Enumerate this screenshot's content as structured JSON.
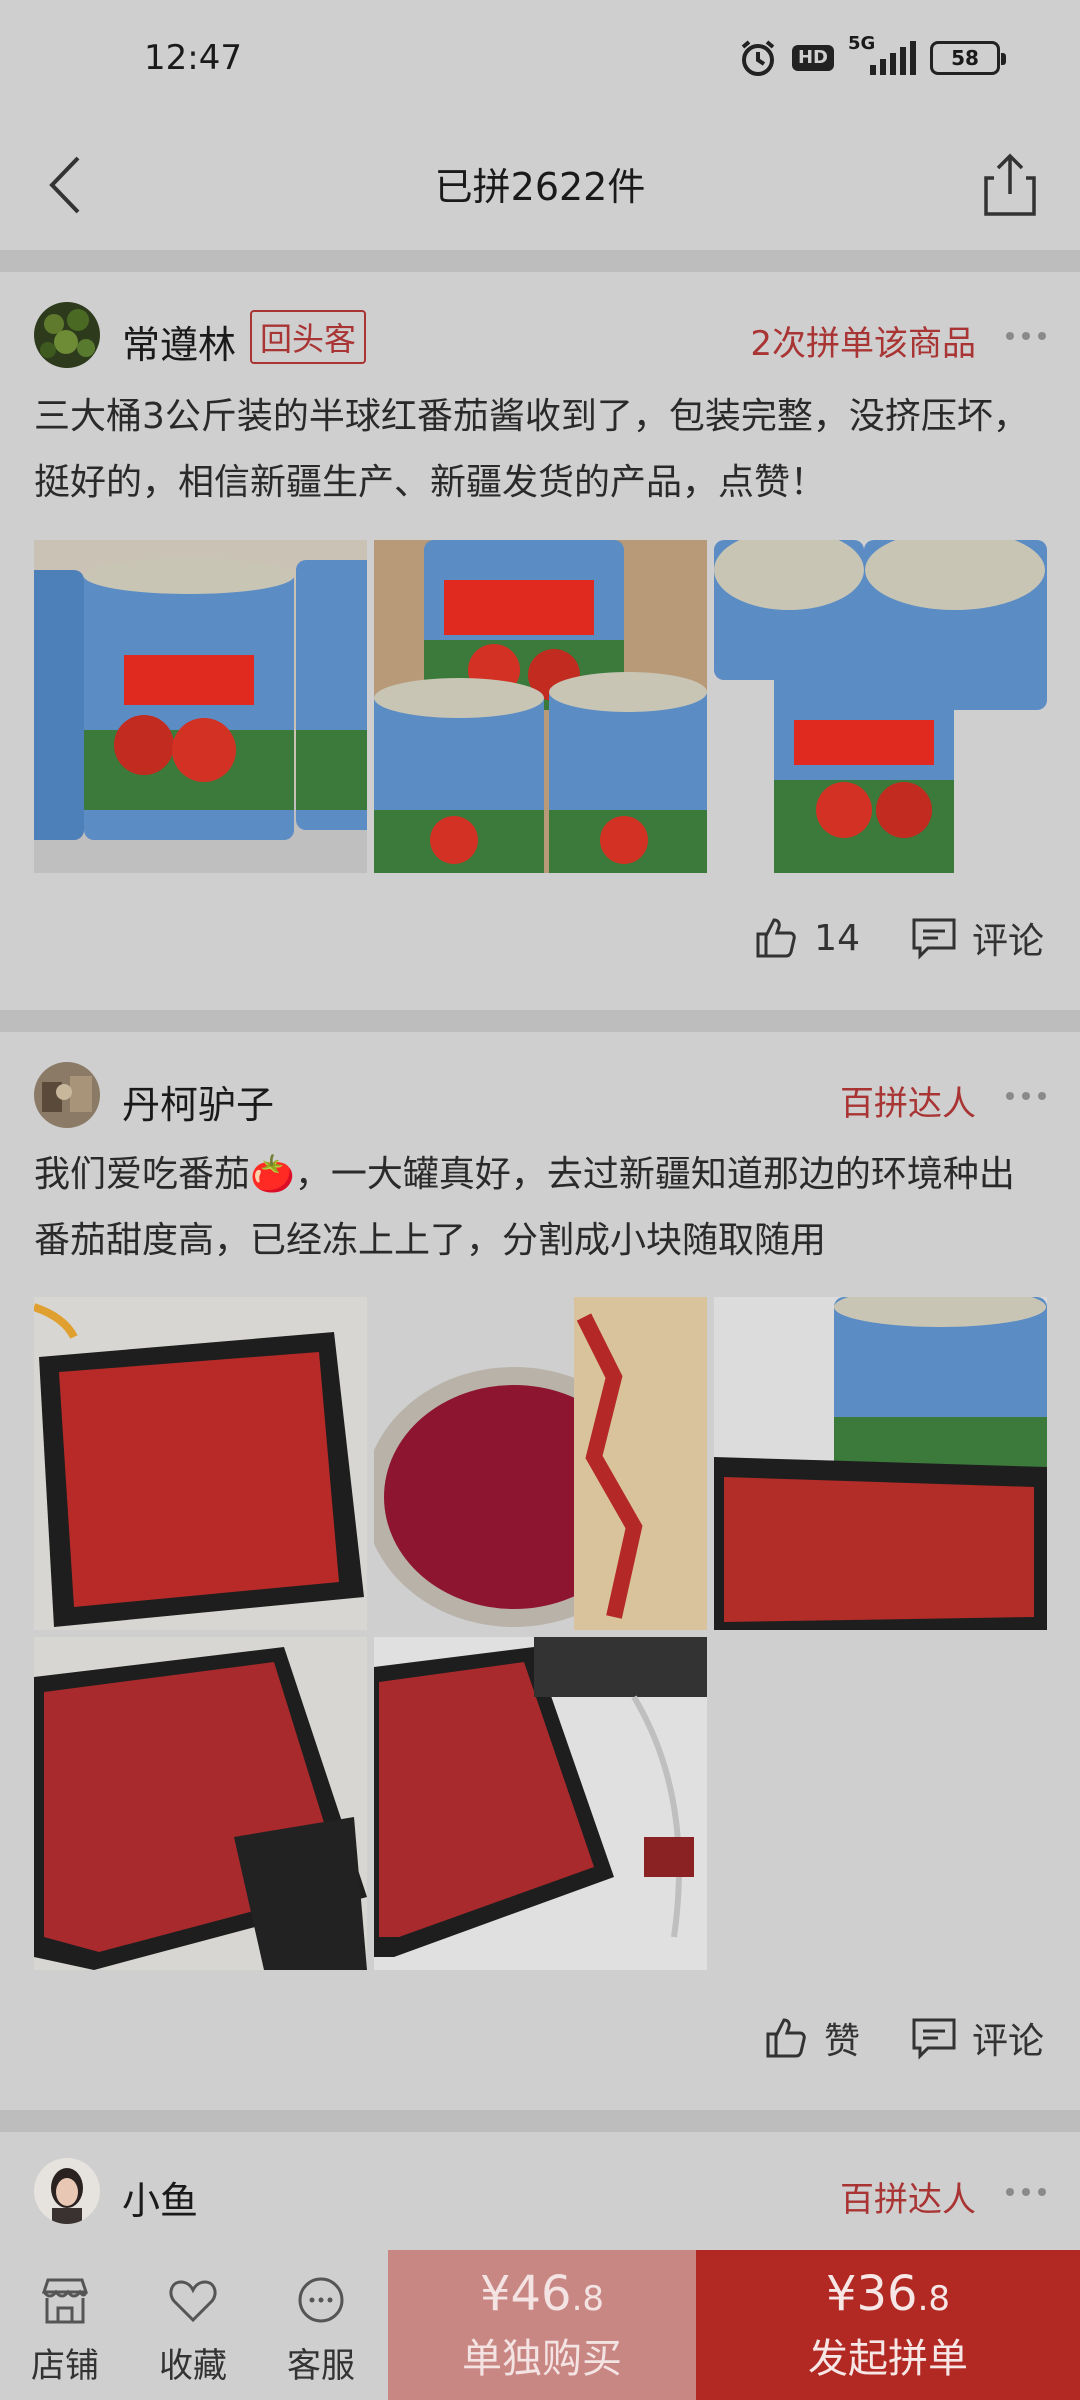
{
  "status": {
    "time": "12:47",
    "hd": "HD",
    "network": "5G",
    "battery": "58"
  },
  "nav": {
    "title": "已拼2622件"
  },
  "reviews": [
    {
      "user": "常遵林",
      "badge": "回头客",
      "tag": "2次拼单该商品",
      "text": "三大桶3公斤装的半球红番茄酱收到了，包装完整，没挤压坏，挺好的，相信新疆生产、新疆发货的产品，点赞！",
      "likes": "14",
      "comment_label": "评论"
    },
    {
      "user": "丹柯驴子",
      "tag": "百拼达人",
      "text": "我们爱吃番茄🍅，一大罐真好，去过新疆知道那边的环境种出番茄甜度高，已经冻上上了，分割成小块随取随用",
      "likes": "赞",
      "comment_label": "评论"
    },
    {
      "user": "小鱼",
      "tag": "百拼达人"
    }
  ],
  "bottom": {
    "shop": "店铺",
    "favorite": "收藏",
    "service": "客服",
    "alone_price_int": "¥46",
    "alone_price_dec": ".8",
    "alone_label": "单独购买",
    "group_price_int": "¥36",
    "group_price_dec": ".8",
    "group_label": "发起拼单"
  },
  "colors": {
    "accent": "#b22822",
    "accent_light": "#c98784",
    "badge": "#a93434",
    "bg": "#cfcfcf"
  }
}
